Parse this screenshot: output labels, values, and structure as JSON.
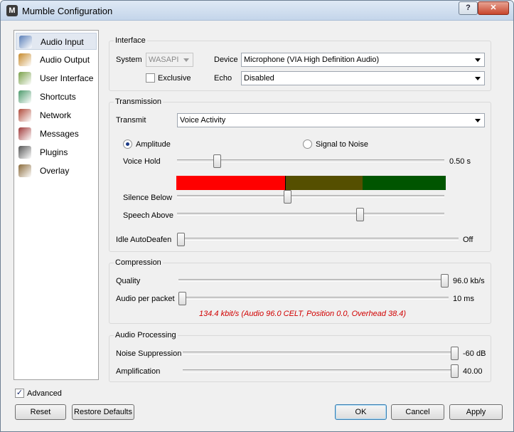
{
  "window": {
    "title": "Mumble Configuration",
    "help_label": "?",
    "close_label": "✕"
  },
  "sidebar": {
    "items": [
      {
        "label": "Audio Input",
        "icon": "audio-input-icon",
        "color": "#5a7fb8"
      },
      {
        "label": "Audio Output",
        "icon": "audio-output-icon",
        "color": "#c78a2b"
      },
      {
        "label": "User Interface",
        "icon": "user-interface-icon",
        "color": "#7aa14a"
      },
      {
        "label": "Shortcuts",
        "icon": "shortcuts-icon",
        "color": "#4d9a6c"
      },
      {
        "label": "Network",
        "icon": "network-icon",
        "color": "#b04a3a"
      },
      {
        "label": "Messages",
        "icon": "messages-icon",
        "color": "#a03a3a"
      },
      {
        "label": "Plugins",
        "icon": "plugins-icon",
        "color": "#555555"
      },
      {
        "label": "Overlay",
        "icon": "overlay-icon",
        "color": "#8a6a3a"
      }
    ]
  },
  "interface": {
    "title": "Interface",
    "system_label": "System",
    "system_value": "WASAPI",
    "device_label": "Device",
    "device_value": "Microphone (VIA High Definition Audio)",
    "exclusive_label": "Exclusive",
    "exclusive_checked": false,
    "echo_label": "Echo",
    "echo_value": "Disabled"
  },
  "transmission": {
    "title": "Transmission",
    "transmit_label": "Transmit",
    "transmit_value": "Voice Activity",
    "amplitude_label": "Amplitude",
    "signal_to_noise_label": "Signal to Noise",
    "selected_mode": "Amplitude",
    "voice_hold_label": "Voice Hold",
    "voice_hold_value": "0.50 s",
    "voice_hold_fraction": 0.14,
    "meter_colors": {
      "red": "#ff0000",
      "yellow": "#554f00",
      "green": "#005500"
    },
    "silence_below_label": "Silence Below",
    "silence_below_fraction": 0.41,
    "speech_above_label": "Speech Above",
    "speech_above_fraction": 0.69,
    "idle_autodeafen_label": "Idle AutoDeafen",
    "idle_autodeafen_value": "Off",
    "idle_autodeafen_fraction": 0.0
  },
  "compression": {
    "title": "Compression",
    "quality_label": "Quality",
    "quality_value": "96.0 kb/s",
    "quality_fraction": 1.0,
    "audio_per_packet_label": "Audio per packet",
    "audio_per_packet_value": "10 ms",
    "audio_per_packet_fraction": 0.0,
    "bitrate_text": "134.4 kbit/s (Audio 96.0 CELT, Position 0.0, Overhead 38.4)"
  },
  "audio_processing": {
    "title": "Audio Processing",
    "noise_suppression_label": "Noise Suppression",
    "noise_suppression_value": "-60 dB",
    "noise_suppression_fraction": 1.0,
    "amplification_label": "Amplification",
    "amplification_value": "40.00",
    "amplification_fraction": 1.0
  },
  "footer": {
    "advanced_label": "Advanced",
    "advanced_checked": true,
    "reset_label": "Reset",
    "restore_defaults_label": "Restore Defaults",
    "ok_label": "OK",
    "cancel_label": "Cancel",
    "apply_label": "Apply"
  }
}
